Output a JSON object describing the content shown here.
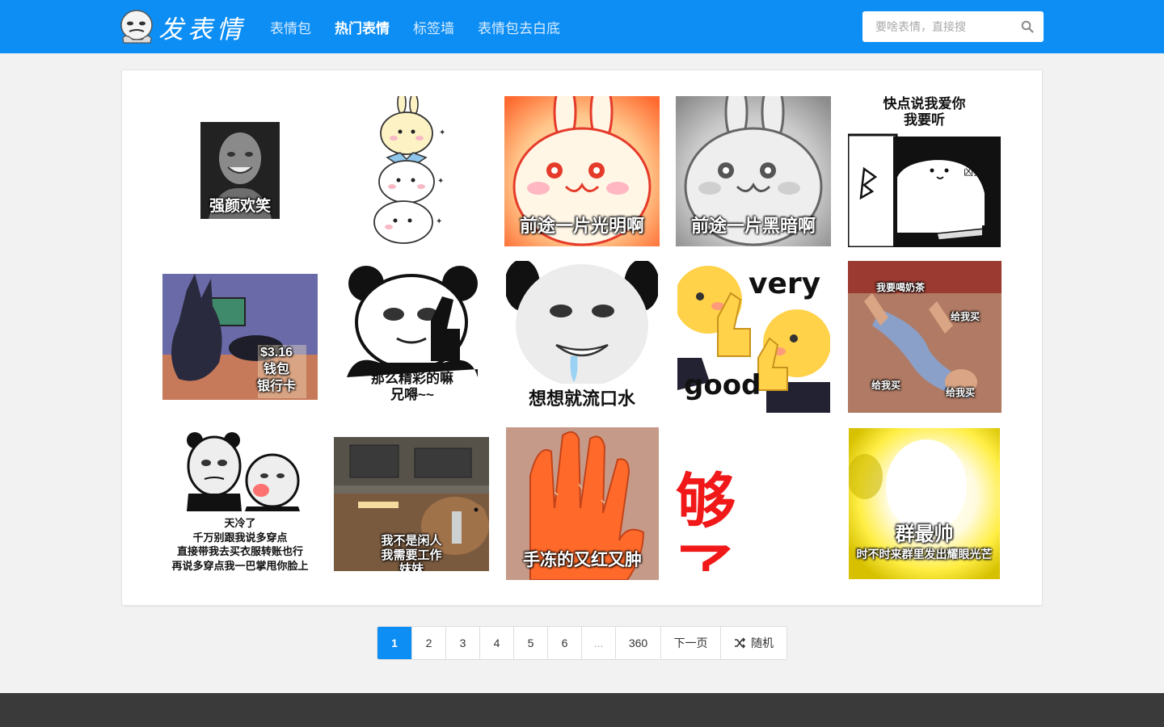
{
  "header": {
    "logo_text": "发表情",
    "nav": [
      {
        "label": "表情包",
        "active": false
      },
      {
        "label": "热门表情",
        "active": true
      },
      {
        "label": "标签墙",
        "active": false
      },
      {
        "label": "表情包去白底",
        "active": false
      }
    ],
    "search": {
      "placeholder": "要啥表情，直接搜",
      "value": ""
    }
  },
  "grid": {
    "items": [
      {
        "caption": "强颜欢笑",
        "icon": "smiling-man-meme"
      },
      {
        "caption": "",
        "icon": "cartoon-rabbit-stack-sticker"
      },
      {
        "caption": "前途一片光明啊",
        "icon": "bright-rabbit-meme"
      },
      {
        "caption": "前途一片黑暗啊",
        "icon": "gray-rabbit-meme"
      },
      {
        "caption": "快点说我爱你 我要听",
        "sub": "凶狠",
        "icon": "cat-with-knife-meme"
      },
      {
        "caption": "$3.16 钱包 银行卡",
        "icon": "cartoon-cat-wallet-meme"
      },
      {
        "caption": "那么精彩的嘛 兄嘚~~",
        "icon": "panda-thumbs-up-meme"
      },
      {
        "caption": "想想就流口水",
        "icon": "panda-drooling-meme"
      },
      {
        "caption_top": "very",
        "caption_bottom": "good",
        "icon": "emoji-thumbs-up-meme"
      },
      {
        "caption": "我要喝奶茶",
        "sub1": "给我买",
        "sub2": "给我买",
        "sub3": "给我买",
        "icon": "tantrum-on-floor-meme"
      },
      {
        "caption": "天冷了 千万别跟我说多穿点 直接带我去买衣服转账也行 再说多穿点我一巴掌甩你脸上",
        "icon": "panda-slap-meme"
      },
      {
        "caption": "我不是闲人 我需要工作 妹妹",
        "icon": "capybara-at-desk-meme"
      },
      {
        "caption": "手冻的又红又肿",
        "icon": "carrot-hand-meme"
      },
      {
        "caption": "够了。",
        "icon": "enough-text-meme"
      },
      {
        "caption": "群最帅",
        "sub": "时不时来群里发出耀眼光芒",
        "icon": "glowing-face-meme"
      }
    ]
  },
  "pagination": {
    "pages": [
      "1",
      "2",
      "3",
      "4",
      "5",
      "6"
    ],
    "ellipsis": "...",
    "last_page": "360",
    "next_label": "下一页",
    "random_label": "随机",
    "current": "1"
  },
  "colors": {
    "brand": "#0d8ef4",
    "footer": "#3a3a3a",
    "enough_red": "#f01818",
    "glow_yellow": "#ffee44"
  }
}
